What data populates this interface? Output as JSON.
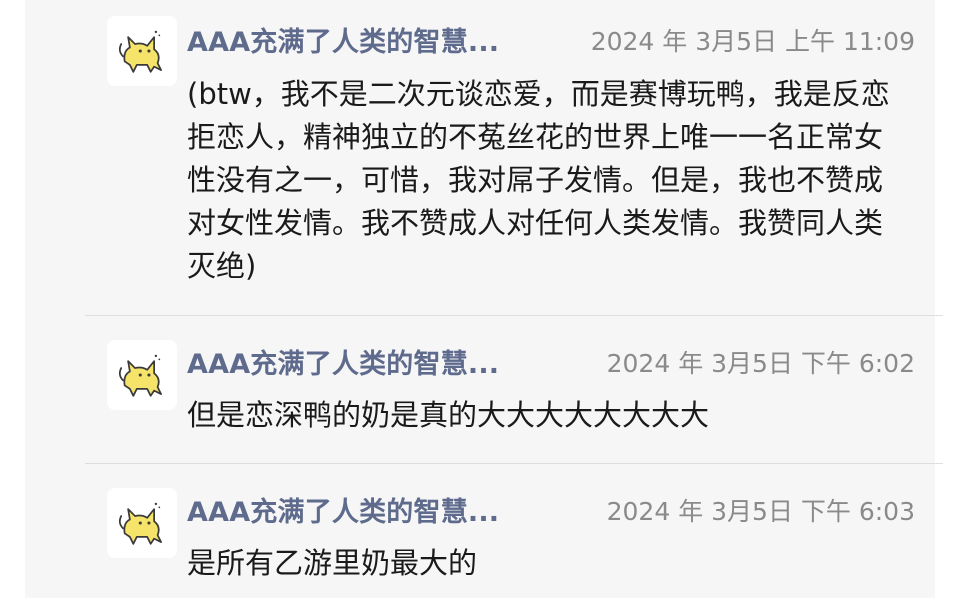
{
  "messages": [
    {
      "author": "AAA充满了人类的智慧...",
      "time": "2024 年 3月5日 上午 11:09",
      "text": "(btw，我不是二次元谈恋爱，而是赛博玩鸭，我是反恋拒恋人，精神独立的不菟丝花的世界上唯一一名正常女性没有之一，可惜，我对屌子发情。但是，我也不赞成对女性发情。我不赞成人对任何人类发情。我赞同人类灭绝)"
    },
    {
      "author": "AAA充满了人类的智慧...",
      "time": "2024 年 3月5日 下午 6:02",
      "text": "但是恋深鸭的奶是真的大大大大大大大大"
    },
    {
      "author": "AAA充满了人类的智慧...",
      "time": "2024 年 3月5日 下午 6:03",
      "text": "是所有乙游里奶最大的"
    }
  ],
  "avatar_icon": "yellow-cat-icon",
  "colors": {
    "author": "#5f6b8d",
    "time": "#8a8a8a",
    "text": "#1a1a1a",
    "panel_bg": "#f6f6f6",
    "avatar_cat": "#f5e36a"
  }
}
